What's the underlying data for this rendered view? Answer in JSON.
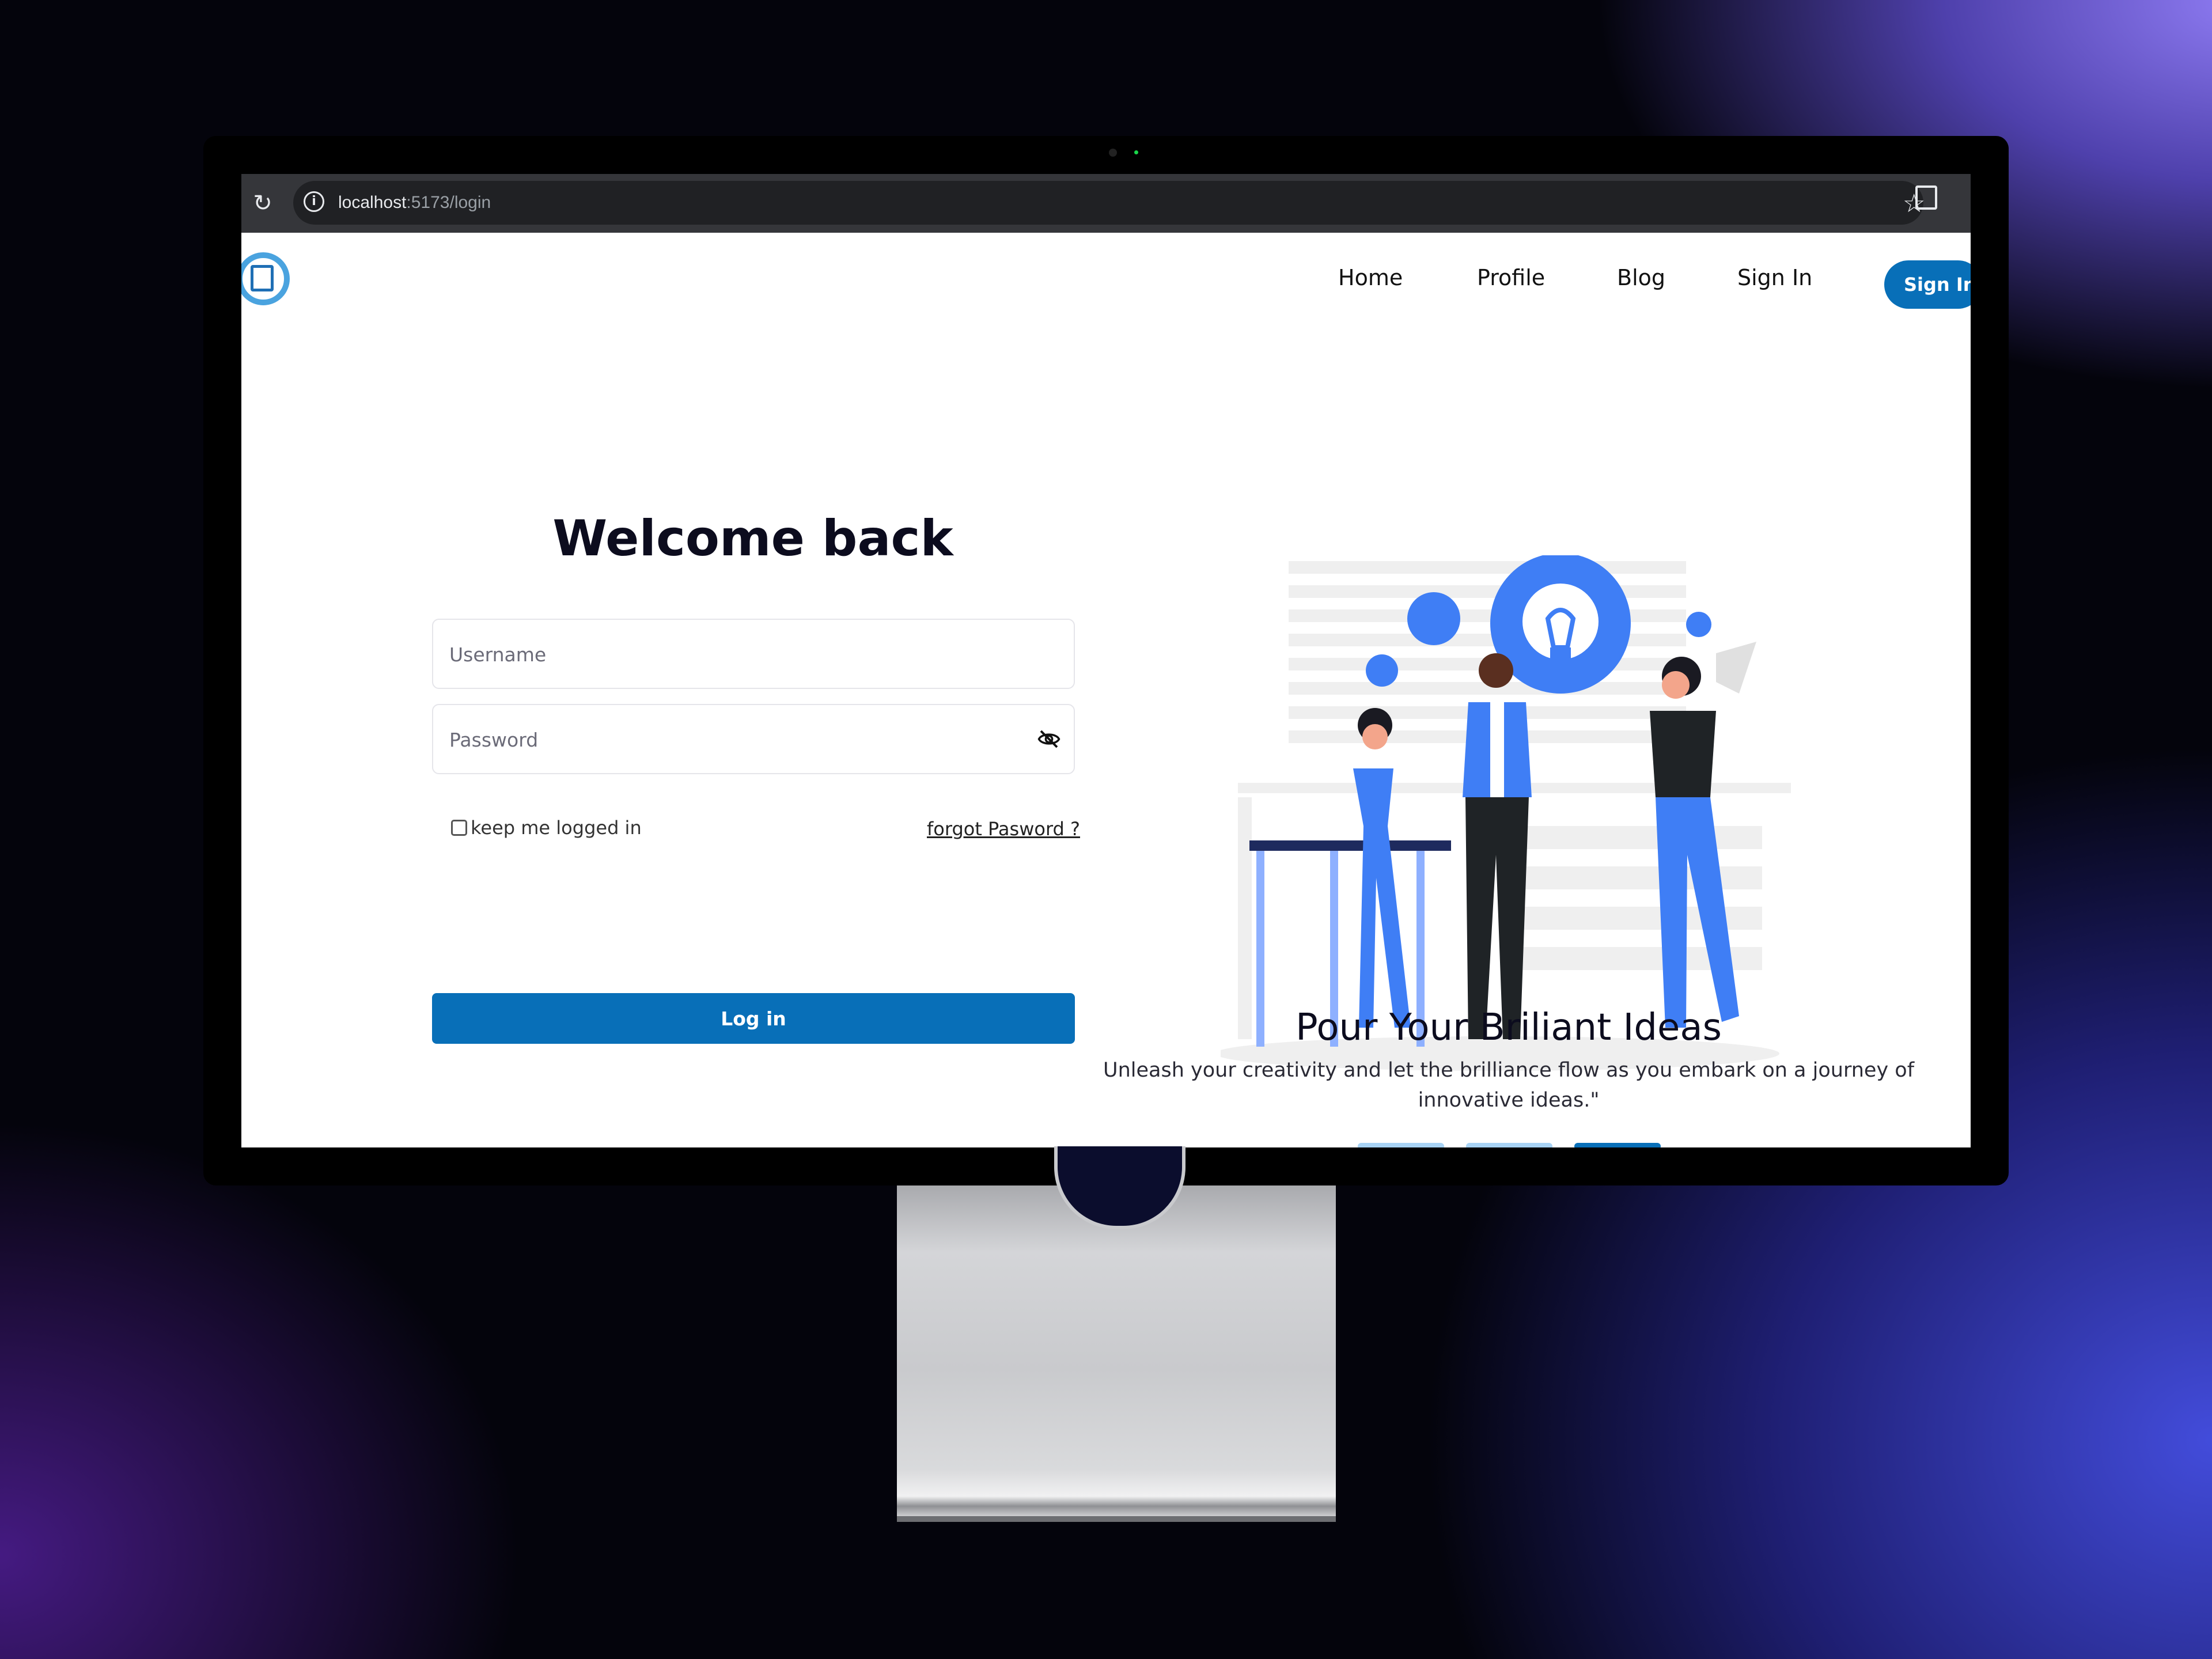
{
  "browser": {
    "url_host": "localhost",
    "url_path": ":5173/login",
    "reload_icon": "reload-icon",
    "star_icon": "star-icon",
    "extensions_icon": "puzzle-icon"
  },
  "nav": {
    "home": "Home",
    "profile": "Profile",
    "blog": "Blog",
    "signin_link": "Sign In",
    "signin_button": "Sign In"
  },
  "login": {
    "heading": "Welcome back",
    "username_placeholder": "Username",
    "username_value": "",
    "password_placeholder": "Password",
    "password_value": "",
    "keep_logged_in": "keep me logged in",
    "keep_logged_in_checked": false,
    "forgot_password": "forgot Pasword ?",
    "submit": "Log in"
  },
  "carousel": {
    "title": "Pour Your Briliant Ideas",
    "text": "Unleash your creativity and let the brilliance flow as you embark on a journey of innovative ideas.\"",
    "slide_count": 3,
    "active_slide": 3
  },
  "colors": {
    "primary": "#086fb8",
    "illustration_blue": "#3f7ef5",
    "dot_inactive": "#a8d3f5"
  }
}
